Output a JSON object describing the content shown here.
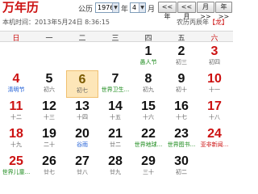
{
  "toolbar": {
    "title": "万年历",
    "calendar_label": "公历",
    "year": "1976",
    "year_unit": "年",
    "month": "4",
    "month_unit": "月",
    "prev_year": "<<年",
    "prev_month": "<<月",
    "next_month": "月>>",
    "next_year": "年>>"
  },
  "status": {
    "now_label": "本机时间：2013年5月24日 8:36:15",
    "lunar_prefix": "农历丙辰年",
    "zodiac": "【龙】"
  },
  "weekdays": [
    "日",
    "一",
    "二",
    "三",
    "四",
    "五",
    "六"
  ],
  "days": [
    {
      "day": "1",
      "sub": "愚人节"
    },
    {
      "day": "2",
      "sub": "初三"
    },
    {
      "day": "3",
      "sub": "初四"
    },
    {
      "day": "4",
      "sub": "清明节"
    },
    {
      "day": "5",
      "sub": "初六"
    },
    {
      "day": "6",
      "sub": "初七"
    },
    {
      "day": "7",
      "sub": "世界卫生..."
    },
    {
      "day": "8",
      "sub": "初九"
    },
    {
      "day": "9",
      "sub": "初十"
    },
    {
      "day": "10",
      "sub": "十一"
    },
    {
      "day": "11",
      "sub": "十二"
    },
    {
      "day": "12",
      "sub": "十三"
    },
    {
      "day": "13",
      "sub": "十四"
    },
    {
      "day": "14",
      "sub": "十五"
    },
    {
      "day": "15",
      "sub": "十六"
    },
    {
      "day": "16",
      "sub": "十七"
    },
    {
      "day": "17",
      "sub": "十八"
    },
    {
      "day": "18",
      "sub": "十九"
    },
    {
      "day": "19",
      "sub": "二十"
    },
    {
      "day": "20",
      "sub": "谷雨"
    },
    {
      "day": "21",
      "sub": "廿二"
    },
    {
      "day": "22",
      "sub": "世界地球..."
    },
    {
      "day": "23",
      "sub": "世界图书..."
    },
    {
      "day": "24",
      "sub": "亚非新闻..."
    },
    {
      "day": "25",
      "sub": "世界儿童..."
    },
    {
      "day": "26",
      "sub": "廿七"
    },
    {
      "day": "27",
      "sub": "廿八"
    },
    {
      "day": "28",
      "sub": "廿九"
    },
    {
      "day": "29",
      "sub": "三十"
    },
    {
      "day": "30",
      "sub": "初二"
    }
  ]
}
